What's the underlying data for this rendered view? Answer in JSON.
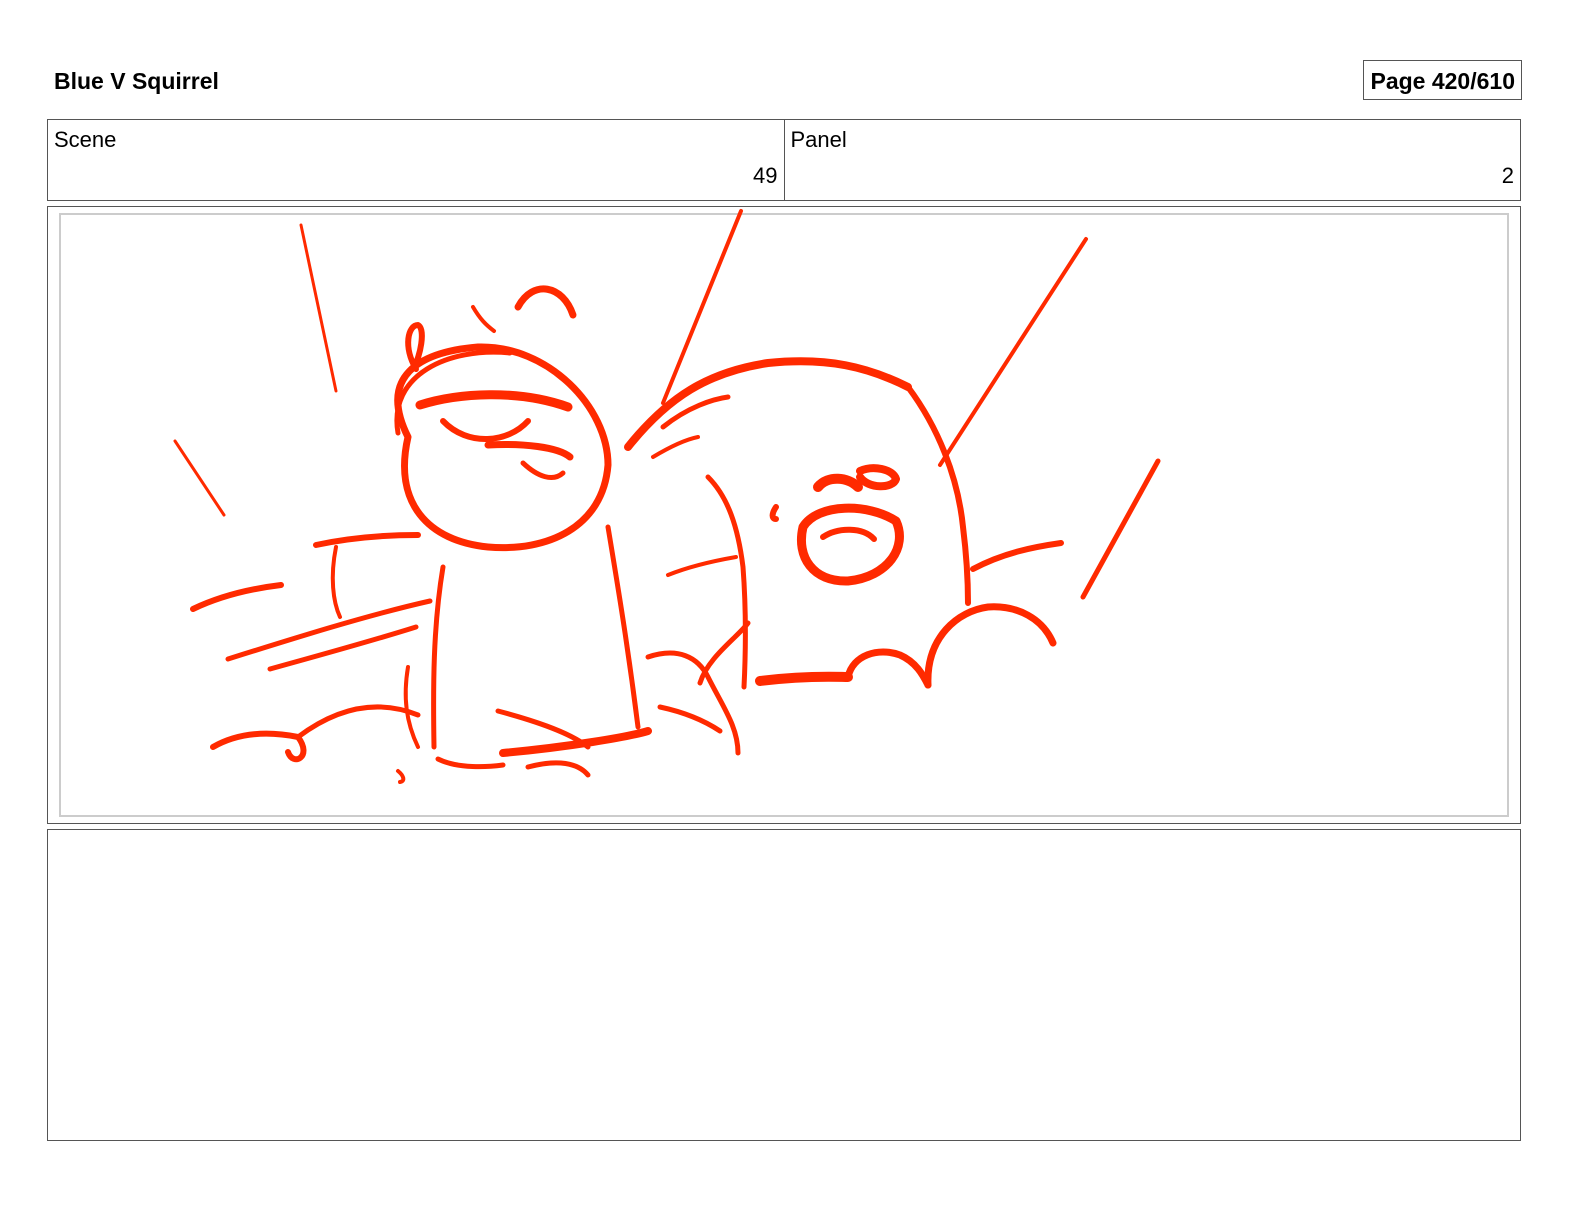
{
  "header": {
    "project_title": "Blue V Squirrel",
    "page_counter": "Page 420/610"
  },
  "info": {
    "scene_label": "Scene",
    "scene_value": "49",
    "panel_label": "Panel",
    "panel_value": "2"
  },
  "sketch": {
    "stroke_color": "#ff2a00",
    "description_icon": "storyboard-sketch-drawing"
  },
  "notes": {
    "text": ""
  }
}
